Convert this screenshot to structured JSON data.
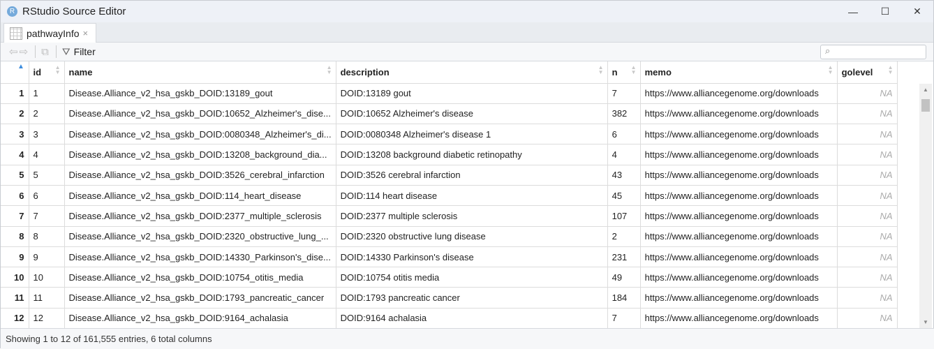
{
  "window": {
    "title": "RStudio Source Editor",
    "logo": "R",
    "minimize": "—",
    "maximize": "☐",
    "close": "✕"
  },
  "tab": {
    "label": "pathwayInfo",
    "close": "×"
  },
  "toolbar": {
    "filter_label": "Filter",
    "search_placeholder": ""
  },
  "columns": [
    "id",
    "name",
    "description",
    "n",
    "memo",
    "golevel"
  ],
  "rows": [
    [
      "1",
      "1",
      "Disease.Alliance_v2_hsa_gskb_DOID:13189_gout",
      "DOID:13189 gout",
      "7",
      "https://www.alliancegenome.org/downloads",
      "NA"
    ],
    [
      "2",
      "2",
      "Disease.Alliance_v2_hsa_gskb_DOID:10652_Alzheimer's_dise...",
      "DOID:10652 Alzheimer's disease",
      "382",
      "https://www.alliancegenome.org/downloads",
      "NA"
    ],
    [
      "3",
      "3",
      "Disease.Alliance_v2_hsa_gskb_DOID:0080348_Alzheimer's_di...",
      "DOID:0080348 Alzheimer's disease 1",
      "6",
      "https://www.alliancegenome.org/downloads",
      "NA"
    ],
    [
      "4",
      "4",
      "Disease.Alliance_v2_hsa_gskb_DOID:13208_background_dia...",
      "DOID:13208 background diabetic retinopathy",
      "4",
      "https://www.alliancegenome.org/downloads",
      "NA"
    ],
    [
      "5",
      "5",
      "Disease.Alliance_v2_hsa_gskb_DOID:3526_cerebral_infarction",
      "DOID:3526 cerebral infarction",
      "43",
      "https://www.alliancegenome.org/downloads",
      "NA"
    ],
    [
      "6",
      "6",
      "Disease.Alliance_v2_hsa_gskb_DOID:114_heart_disease",
      "DOID:114 heart disease",
      "45",
      "https://www.alliancegenome.org/downloads",
      "NA"
    ],
    [
      "7",
      "7",
      "Disease.Alliance_v2_hsa_gskb_DOID:2377_multiple_sclerosis",
      "DOID:2377 multiple sclerosis",
      "107",
      "https://www.alliancegenome.org/downloads",
      "NA"
    ],
    [
      "8",
      "8",
      "Disease.Alliance_v2_hsa_gskb_DOID:2320_obstructive_lung_...",
      "DOID:2320 obstructive lung disease",
      "2",
      "https://www.alliancegenome.org/downloads",
      "NA"
    ],
    [
      "9",
      "9",
      "Disease.Alliance_v2_hsa_gskb_DOID:14330_Parkinson's_dise...",
      "DOID:14330 Parkinson's disease",
      "231",
      "https://www.alliancegenome.org/downloads",
      "NA"
    ],
    [
      "10",
      "10",
      "Disease.Alliance_v2_hsa_gskb_DOID:10754_otitis_media",
      "DOID:10754 otitis media",
      "49",
      "https://www.alliancegenome.org/downloads",
      "NA"
    ],
    [
      "11",
      "11",
      "Disease.Alliance_v2_hsa_gskb_DOID:1793_pancreatic_cancer",
      "DOID:1793 pancreatic cancer",
      "184",
      "https://www.alliancegenome.org/downloads",
      "NA"
    ],
    [
      "12",
      "12",
      "Disease.Alliance_v2_hsa_gskb_DOID:9164_achalasia",
      "DOID:9164 achalasia",
      "7",
      "https://www.alliancegenome.org/downloads",
      "NA"
    ]
  ],
  "status": "Showing 1 to 12 of 161,555 entries, 6 total columns"
}
